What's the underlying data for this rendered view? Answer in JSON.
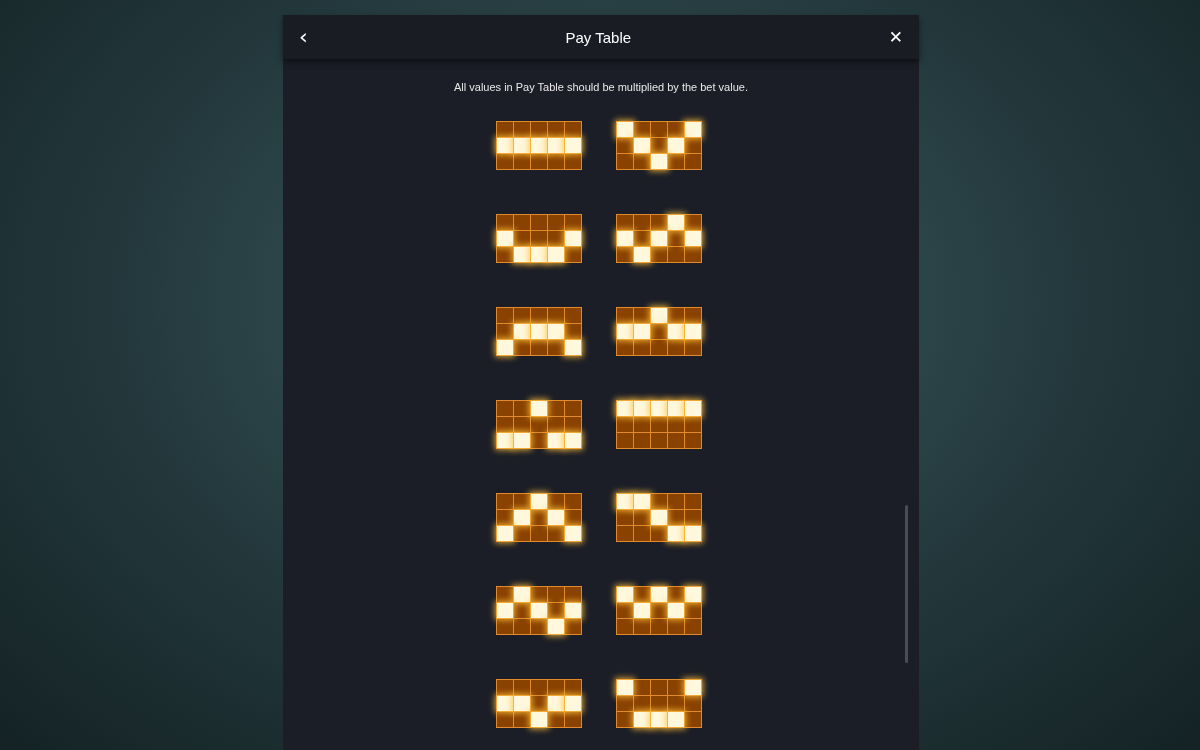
{
  "dialog": {
    "title": "Pay Table",
    "back_icon": "‹",
    "close_icon": "✕",
    "note": "All values in Pay Table should be multiplied by the bet value."
  },
  "paylines": [
    {
      "grid": [
        [
          false,
          false,
          false,
          false,
          false
        ],
        [
          true,
          true,
          true,
          true,
          true
        ],
        [
          false,
          false,
          false,
          false,
          false
        ]
      ]
    },
    {
      "grid": [
        [
          true,
          false,
          false,
          false,
          true
        ],
        [
          false,
          true,
          false,
          true,
          false
        ],
        [
          false,
          false,
          true,
          false,
          false
        ]
      ]
    },
    {
      "grid": [
        [
          false,
          false,
          false,
          false,
          false
        ],
        [
          true,
          false,
          false,
          false,
          true
        ],
        [
          false,
          true,
          true,
          true,
          false
        ]
      ]
    },
    {
      "grid": [
        [
          false,
          false,
          false,
          true,
          false
        ],
        [
          true,
          false,
          true,
          false,
          true
        ],
        [
          false,
          true,
          false,
          false,
          false
        ]
      ]
    },
    {
      "grid": [
        [
          false,
          false,
          false,
          false,
          false
        ],
        [
          false,
          true,
          true,
          true,
          false
        ],
        [
          true,
          false,
          false,
          false,
          true
        ]
      ]
    },
    {
      "grid": [
        [
          false,
          false,
          true,
          false,
          false
        ],
        [
          true,
          true,
          false,
          true,
          true
        ],
        [
          false,
          false,
          false,
          false,
          false
        ]
      ]
    },
    {
      "grid": [
        [
          false,
          false,
          true,
          false,
          false
        ],
        [
          false,
          false,
          false,
          false,
          false
        ],
        [
          true,
          true,
          false,
          true,
          true
        ]
      ]
    },
    {
      "grid": [
        [
          true,
          true,
          true,
          true,
          true
        ],
        [
          false,
          false,
          false,
          false,
          false
        ],
        [
          false,
          false,
          false,
          false,
          false
        ]
      ]
    },
    {
      "grid": [
        [
          false,
          false,
          true,
          false,
          false
        ],
        [
          false,
          true,
          false,
          true,
          false
        ],
        [
          true,
          false,
          false,
          false,
          true
        ]
      ]
    },
    {
      "grid": [
        [
          true,
          true,
          false,
          false,
          false
        ],
        [
          false,
          false,
          true,
          false,
          false
        ],
        [
          false,
          false,
          false,
          true,
          true
        ]
      ]
    },
    {
      "grid": [
        [
          false,
          true,
          false,
          false,
          false
        ],
        [
          true,
          false,
          true,
          false,
          true
        ],
        [
          false,
          false,
          false,
          true,
          false
        ]
      ]
    },
    {
      "grid": [
        [
          true,
          false,
          true,
          false,
          true
        ],
        [
          false,
          true,
          false,
          true,
          false
        ],
        [
          false,
          false,
          false,
          false,
          false
        ]
      ]
    },
    {
      "grid": [
        [
          false,
          false,
          false,
          false,
          false
        ],
        [
          true,
          true,
          false,
          true,
          true
        ],
        [
          false,
          false,
          true,
          false,
          false
        ]
      ]
    },
    {
      "grid": [
        [
          true,
          false,
          false,
          false,
          true
        ],
        [
          false,
          false,
          false,
          false,
          false
        ],
        [
          false,
          true,
          true,
          true,
          false
        ]
      ]
    }
  ]
}
